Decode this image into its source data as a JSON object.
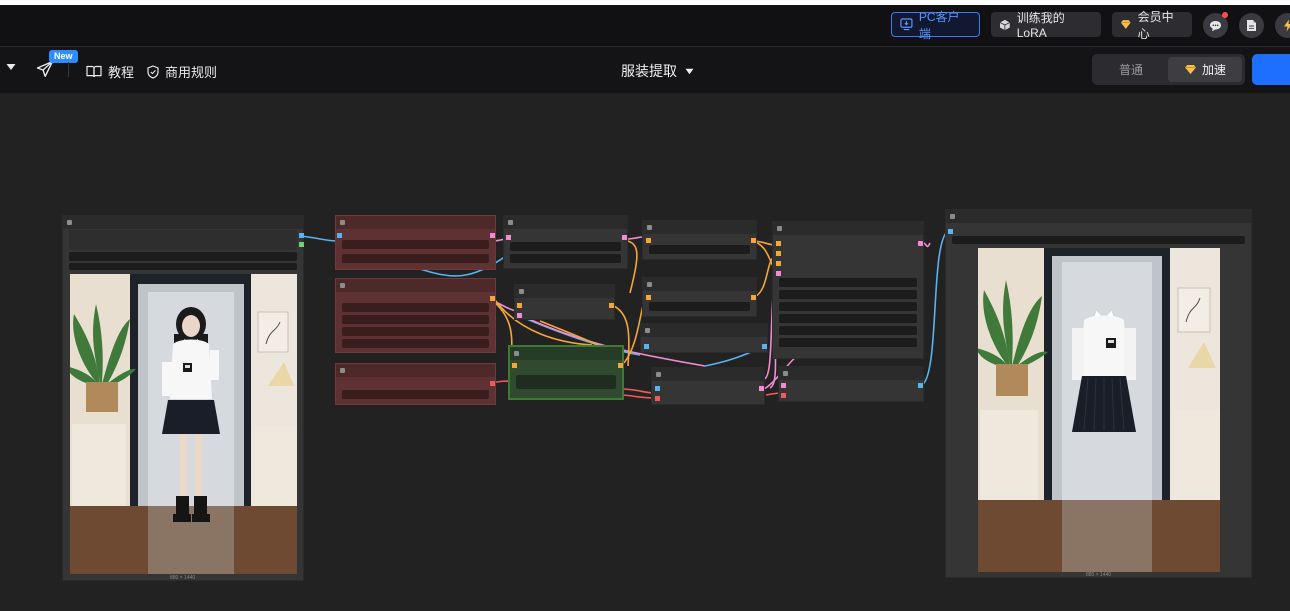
{
  "topbar": {
    "pc_client_label": "PC客户端",
    "train_lora_label": "训练我的LoRA",
    "vip_center_label": "会员中心"
  },
  "toolbar": {
    "new_badge": "New",
    "tutorial_label": "教程",
    "commercial_rules_label": "商用规则",
    "workflow_title": "服装提取",
    "mode_normal_label": "普通",
    "mode_fast_label": "加速",
    "selected_mode": "加速"
  },
  "canvas": {
    "input_image_size": "880 × 1440",
    "output_image_size": "880 × 1440"
  },
  "colors": {
    "accent_blue": "#1f6fff",
    "node_red": "#5e3232",
    "node_green": "#2f4a2f",
    "wire_blue": "#5ab2f0",
    "wire_orange": "#f3a73a",
    "wire_pink": "#f08cd2",
    "wire_red": "#f05a5a"
  }
}
